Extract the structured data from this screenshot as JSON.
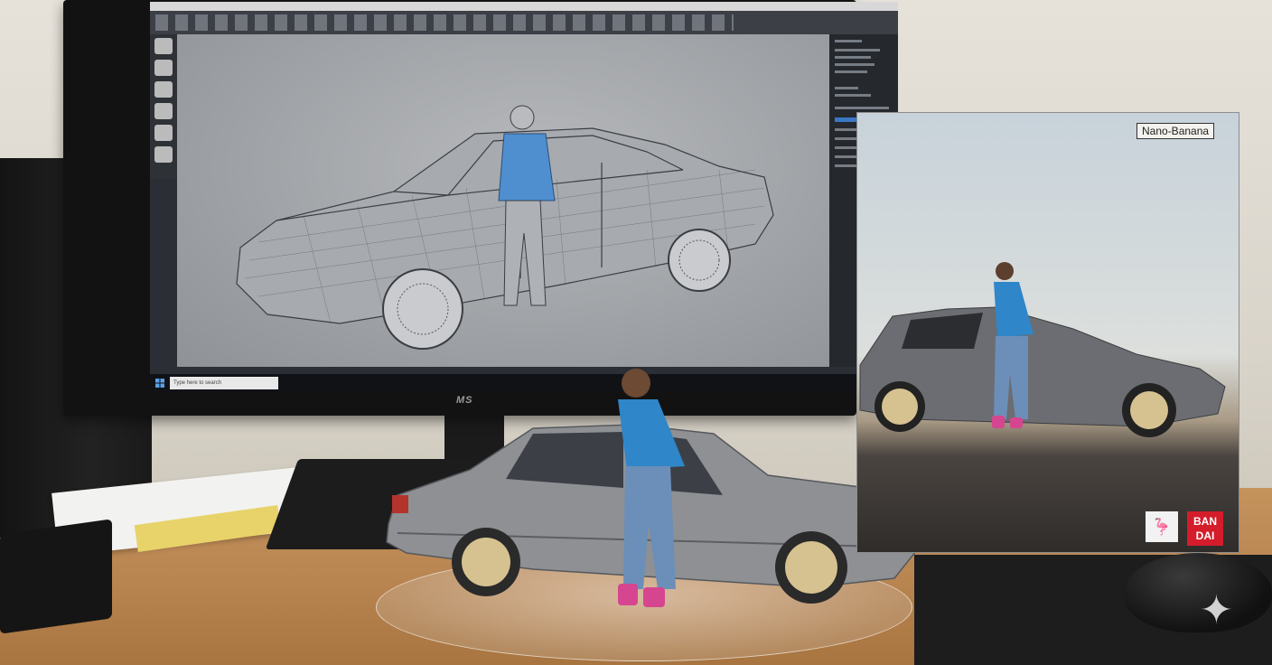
{
  "monitor": {
    "app_title": "",
    "brand": "MS",
    "taskbar_search_placeholder": "Type here to search"
  },
  "box": {
    "label": "Nano-Banana",
    "brand_logo": "BAN DAI",
    "bird_icon": "bird-icon",
    "caption": ""
  },
  "colors": {
    "desk": "#b98551",
    "wall": "#e2ded6",
    "car": "#8e9094",
    "shirt": "#2f86c8",
    "jeans": "#6b8fb8",
    "shoes": "#d6458f",
    "box_brand": "#d41c2b",
    "selection": "#3d7fd6"
  },
  "watermark": {
    "icon": "sparkle-icon"
  }
}
